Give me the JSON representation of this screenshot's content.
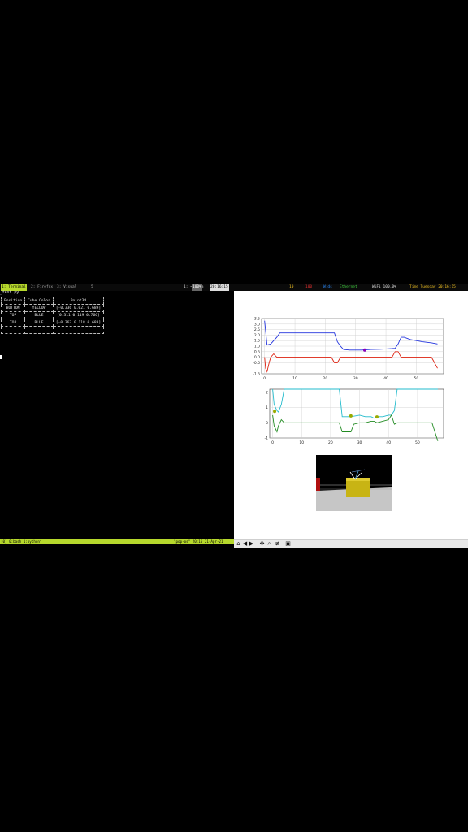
{
  "status_bar": {
    "workspace_active": "1: Terminal",
    "workspaces": [
      "2: Firefox",
      "3: Visual",
      "5"
    ],
    "file_info": "1: ~/.vim",
    "indicator_box": "100%",
    "clock_box": "20:16:15",
    "right_items": [
      "10",
      "100",
      "W:ds",
      "Ethernet",
      "WiFi 100.0%",
      "Time Tuesday 20:16:15"
    ],
    "right_colors": [
      "#f0c020",
      "#e03030",
      "#2a8cff",
      "#40d040",
      "#e0e0e0",
      "#f0c020"
    ]
  },
  "terminal": {
    "title": "_test.py",
    "table": {
      "headers": [
        "Position",
        "Cube Color",
        "Point3d"
      ],
      "rows": [
        [
          "BOTTOM",
          "YELLOW",
          "[-0.336 0.021 0.689]"
        ],
        [
          "TOP",
          "BLUE",
          "[0.311 0.119 0.766]"
        ],
        [
          "TOP",
          "BLUE",
          "[-0.367 0.118 0.683]"
        ],
        [
          "",
          "",
          ""
        ]
      ]
    }
  },
  "tmux_bar": {
    "left": "[0] 0:bash  1:python*",
    "right": "\"pop-os\" 20:16 21-Apr-21"
  },
  "toolbar": {
    "buttons": [
      "home-icon",
      "back-icon",
      "forward-icon",
      "pan-icon",
      "zoom-icon",
      "configure-icon",
      "save-icon"
    ]
  },
  "chart_data": [
    {
      "type": "line",
      "xlim": [
        -1,
        59
      ],
      "ylim": [
        -1.5,
        3.5
      ],
      "xticks": [
        "0",
        "10",
        "20",
        "30",
        "40",
        "50"
      ],
      "yticks": [
        "-1.5",
        "-0.5",
        "0.0",
        "0.5",
        "1.0",
        "1.5",
        "2.0",
        "2.5",
        "3.0",
        "3.5"
      ],
      "grid": true,
      "series": [
        {
          "color": "#2233dd",
          "x": [
            0,
            0.3,
            0.8,
            2,
            3,
            4,
            5,
            8,
            12,
            16,
            20,
            22,
            23,
            24,
            25,
            26,
            28,
            30,
            32,
            35,
            38,
            40,
            42,
            43,
            44,
            45,
            46,
            48,
            50,
            52,
            55,
            57
          ],
          "y": [
            3.3,
            2.4,
            1.1,
            1.2,
            1.5,
            1.8,
            2.2,
            2.2,
            2.2,
            2.2,
            2.2,
            2.2,
            2.2,
            1.4,
            1.0,
            0.7,
            0.65,
            0.65,
            0.65,
            0.7,
            0.72,
            0.75,
            0.78,
            0.8,
            1.2,
            1.8,
            1.8,
            1.6,
            1.5,
            1.4,
            1.3,
            1.2
          ]
        },
        {
          "color": "#dd2211",
          "x": [
            0,
            0.3,
            0.8,
            1.5,
            2,
            3,
            4,
            5,
            8,
            12,
            16,
            20,
            22,
            23,
            24,
            25,
            26,
            30,
            35,
            40,
            42,
            43,
            44,
            45,
            46,
            50,
            55,
            57
          ],
          "y": [
            0.0,
            -1.0,
            -1.3,
            -0.5,
            0.0,
            0.3,
            0.0,
            0.0,
            0.0,
            0.0,
            0.0,
            0.0,
            0.0,
            -0.5,
            -0.5,
            0.0,
            0.0,
            0.0,
            0.0,
            0.0,
            0.0,
            0.5,
            0.5,
            0.0,
            0.0,
            0.0,
            0.0,
            -1.0
          ]
        }
      ],
      "markers": [
        {
          "x": 33,
          "y": 0.65,
          "color": "#8800bb"
        }
      ]
    },
    {
      "type": "line",
      "xlim": [
        -1,
        59
      ],
      "ylim": [
        -1,
        2.2
      ],
      "xticks": [
        "0",
        "10",
        "20",
        "30",
        "40",
        "50"
      ],
      "yticks": [
        "-1",
        "0",
        "1",
        "2"
      ],
      "grid": true,
      "series": [
        {
          "color": "#22bbcc",
          "x": [
            0,
            0.5,
            1.5,
            2,
            3,
            4,
            6,
            10,
            15,
            20,
            22,
            23,
            24,
            25,
            27,
            30,
            32,
            34,
            35,
            36,
            38,
            40,
            41,
            42,
            43,
            45,
            50,
            55,
            57
          ],
          "y": [
            2.2,
            1.2,
            0.8,
            0.7,
            1.2,
            2.2,
            2.2,
            2.2,
            2.2,
            2.2,
            2.2,
            2.2,
            0.4,
            0.4,
            0.4,
            0.5,
            0.4,
            0.4,
            0.3,
            0.4,
            0.4,
            0.5,
            0.5,
            0.8,
            2.2,
            2.2,
            2.2,
            2.2,
            2.2
          ]
        },
        {
          "color": "#228b22",
          "x": [
            0,
            0.5,
            1.5,
            2,
            3,
            4,
            5,
            10,
            15,
            20,
            22,
            23,
            24,
            25,
            27,
            28,
            30,
            32,
            34,
            35,
            36,
            38,
            40,
            41,
            42,
            43,
            45,
            50,
            55,
            57
          ],
          "y": [
            0.5,
            -0.2,
            -0.6,
            -0.2,
            0.2,
            0.0,
            0.0,
            0.0,
            0.0,
            0.0,
            0.0,
            0.0,
            -0.6,
            -0.6,
            -0.6,
            -0.1,
            0.0,
            0.0,
            0.1,
            0.1,
            0.0,
            0.1,
            0.2,
            0.5,
            -0.1,
            0.0,
            0.0,
            0.0,
            0.0,
            -1.2
          ]
        }
      ],
      "markers": [
        {
          "x": 0.7,
          "y": 0.75,
          "color": "#99aa00"
        },
        {
          "x": 27,
          "y": 0.45,
          "color": "#99aa00"
        },
        {
          "x": 36,
          "y": 0.38,
          "color": "#99aa00"
        }
      ]
    }
  ],
  "camera": {
    "cube_color": "#c8b414",
    "background_color": "#000000",
    "floor_color": "#c8c8c8",
    "side_cube_color": "#b01010"
  }
}
